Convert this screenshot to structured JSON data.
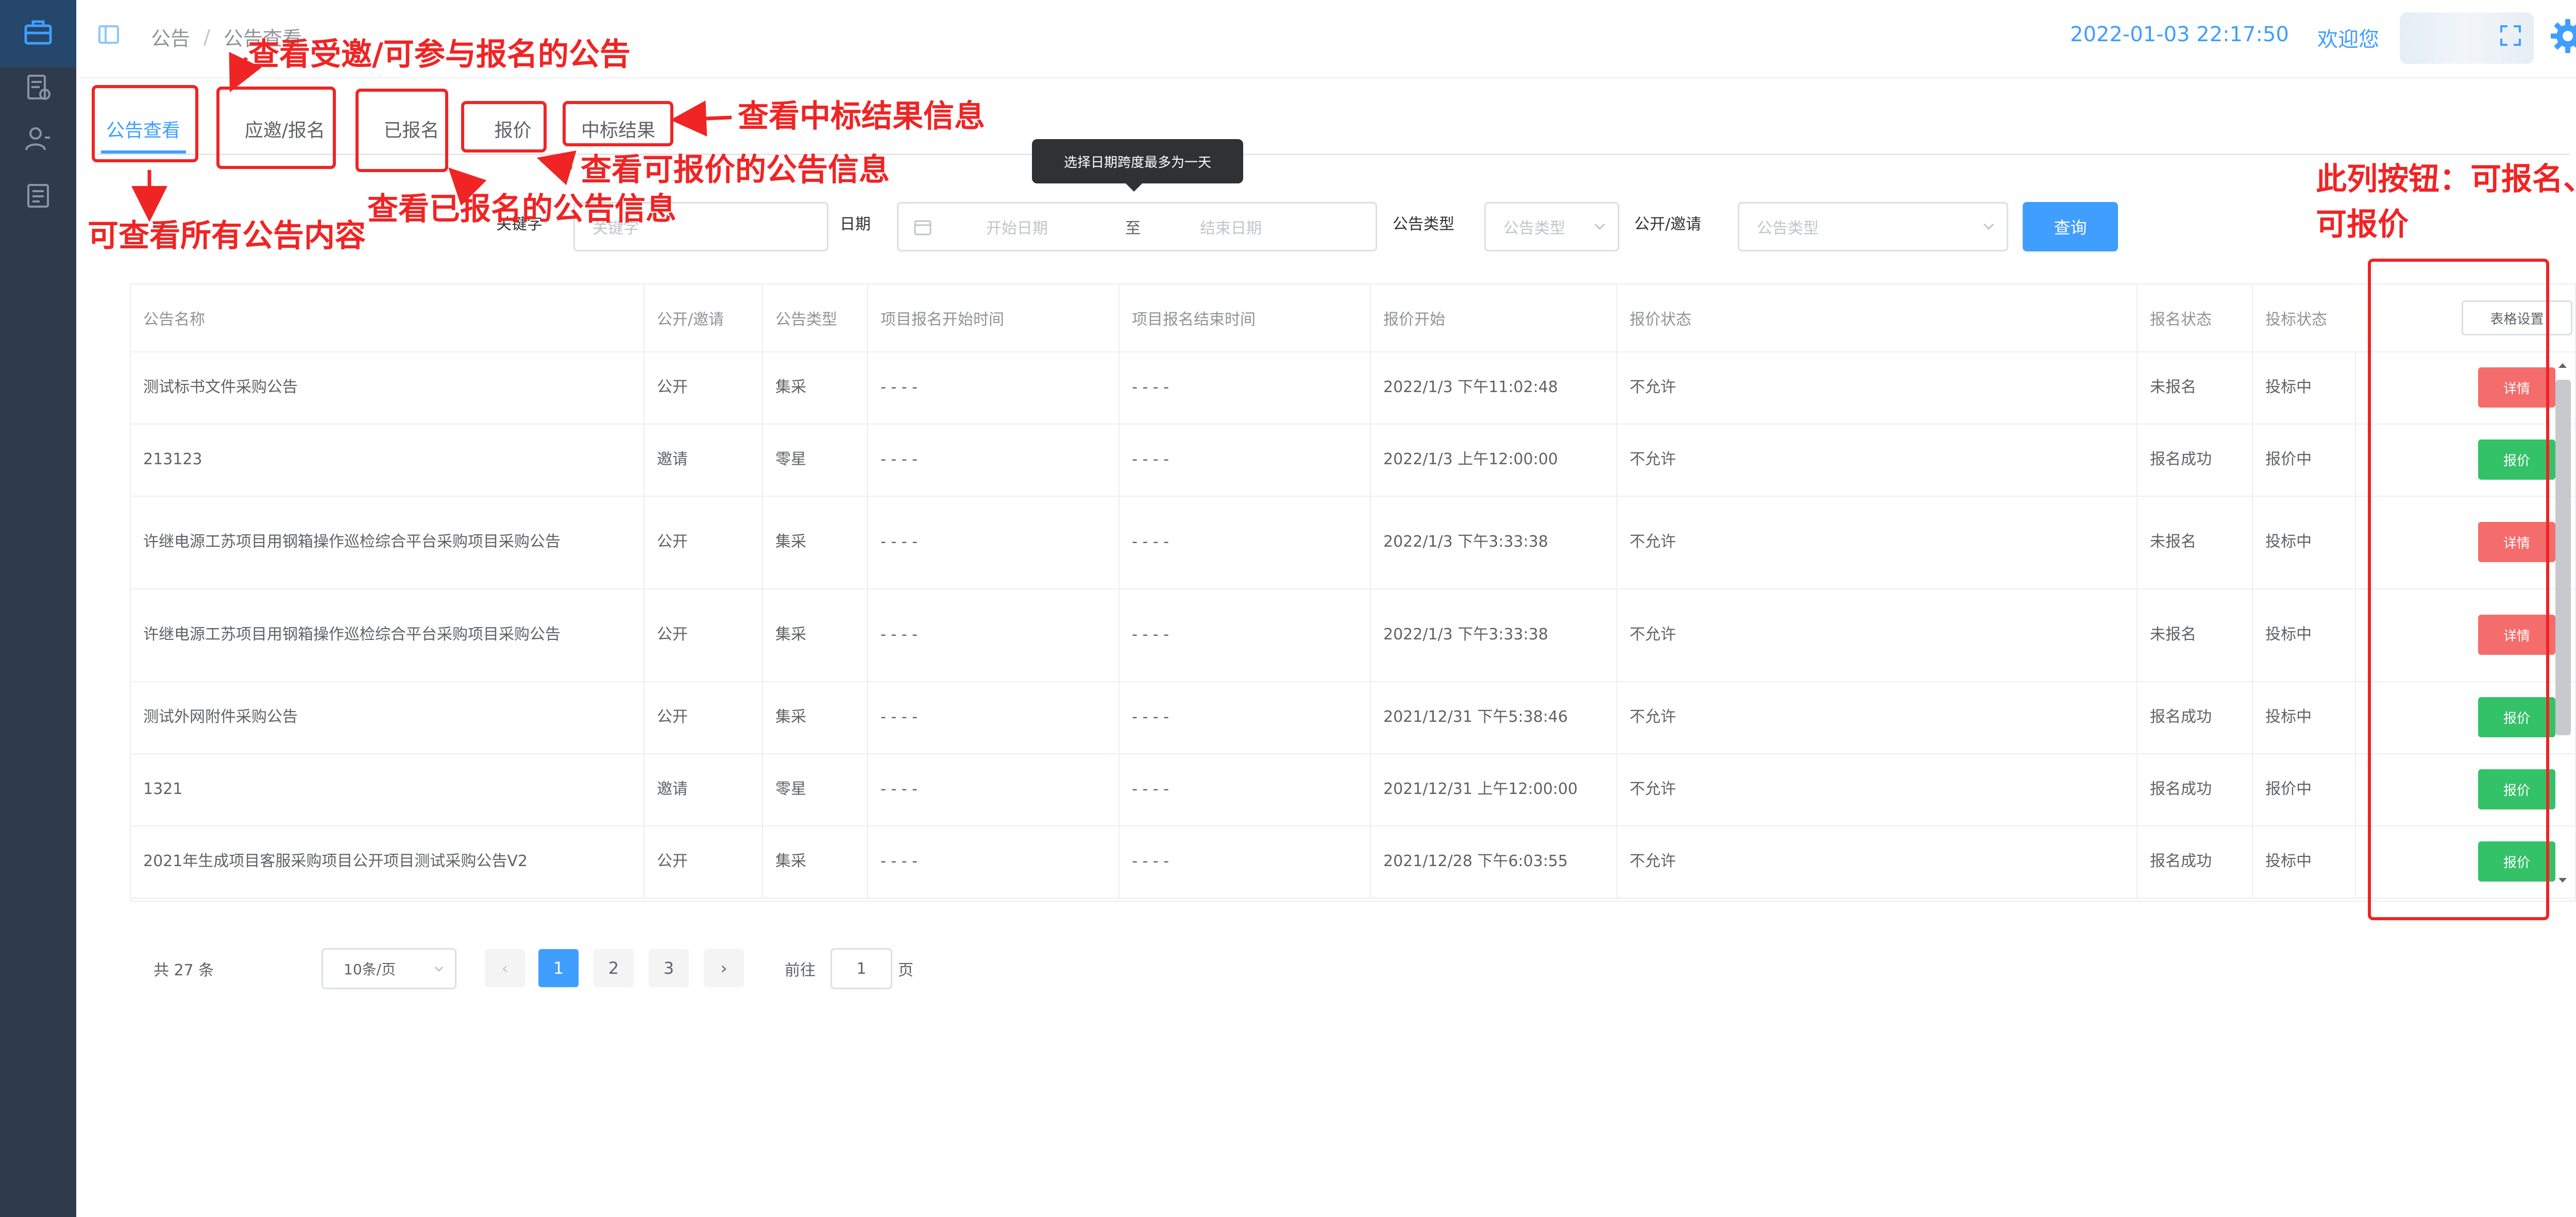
{
  "breadcrumb": {
    "home": "公告",
    "current": "公告查看"
  },
  "header": {
    "datetime": "2022-01-03 22:17:50",
    "welcome": "欢迎您"
  },
  "tabs": [
    {
      "label": "公告查看"
    },
    {
      "label": "应邀/报名"
    },
    {
      "label": "已报名"
    },
    {
      "label": "报价"
    },
    {
      "label": "中标结果"
    }
  ],
  "tooltip": "选择日期跨度最多为一天",
  "filters": {
    "keyword_label": "关键字",
    "keyword_placeholder": "关键字",
    "date_label": "日期",
    "date_start_placeholder": "开始日期",
    "date_sep": "至",
    "date_end_placeholder": "结束日期",
    "type_label": "公告类型",
    "type_placeholder": "公告类型",
    "mode_label": "公开/邀请",
    "mode_placeholder": "公告类型",
    "query_button": "查询"
  },
  "table": {
    "columns": [
      "公告名称",
      "公开/邀请",
      "公告类型",
      "项目报名开始时间",
      "项目报名结束时间",
      "报价开始",
      "报价状态",
      "报名状态",
      "投标状态"
    ],
    "column_settings": "表格设置",
    "rows": [
      {
        "name": "测试标书文件采购公告",
        "mode": "公开",
        "type": "集采",
        "start": "- - - -",
        "end": "- - - -",
        "quote": "2022/1/3 下午11:02:48",
        "qstatus": "不允许",
        "reg": "未报名",
        "bid": "投标中",
        "action": "详情",
        "color": "#f56c6c"
      },
      {
        "name": "213123",
        "mode": "邀请",
        "type": "零星",
        "start": "- - - -",
        "end": "- - - -",
        "quote": "2022/1/3 上午12:00:00",
        "qstatus": "不允许",
        "reg": "报名成功",
        "bid": "报价中",
        "action": "报价",
        "color": "#34c268"
      },
      {
        "name": "许继电源工苏项目用钢箱操作巡检综合平台采购项目采购公告",
        "mode": "公开",
        "type": "集采",
        "start": "- - - -",
        "end": "- - - -",
        "quote": "2022/1/3 下午3:33:38",
        "qstatus": "不允许",
        "reg": "未报名",
        "bid": "投标中",
        "action": "详情",
        "color": "#f56c6c"
      },
      {
        "name": "许继电源工苏项目用钢箱操作巡检综合平台采购项目采购公告",
        "mode": "公开",
        "type": "集采",
        "start": "- - - -",
        "end": "- - - -",
        "quote": "2022/1/3 下午3:33:38",
        "qstatus": "不允许",
        "reg": "未报名",
        "bid": "投标中",
        "action": "详情",
        "color": "#f56c6c"
      },
      {
        "name": "测试外网附件采购公告",
        "mode": "公开",
        "type": "集采",
        "start": "- - - -",
        "end": "- - - -",
        "quote": "2021/12/31 下午5:38:46",
        "qstatus": "不允许",
        "reg": "报名成功",
        "bid": "投标中",
        "action": "报价",
        "color": "#34c268"
      },
      {
        "name": "1321",
        "mode": "邀请",
        "type": "零星",
        "start": "- - - -",
        "end": "- - - -",
        "quote": "2021/12/31 上午12:00:00",
        "qstatus": "不允许",
        "reg": "报名成功",
        "bid": "报价中",
        "action": "报价",
        "color": "#34c268"
      },
      {
        "name": "2021年生成项目客服采购项目公开项目测试采购公告V2",
        "mode": "公开",
        "type": "集采",
        "start": "- - - -",
        "end": "- - - -",
        "quote": "2021/12/28 下午6:03:55",
        "qstatus": "不允许",
        "reg": "报名成功",
        "bid": "投标中",
        "action": "报价",
        "color": "#34c268"
      }
    ]
  },
  "pagination": {
    "total": "共 27 条",
    "page_size": "10条/页",
    "prev": "‹",
    "pages": [
      "1",
      "2",
      "3"
    ],
    "next": "›",
    "goto_label": "前往",
    "goto_value": "1",
    "goto_suffix": "页"
  },
  "annotations": {
    "invited": "查看受邀/可参与报名的公告",
    "winning": "查看中标结果信息",
    "quotable": "查看可报价的公告信息",
    "registered": "查看已报名的公告信息",
    "all": "可查看所有公告内容",
    "column_note_1": "此列按钮：可报名、",
    "column_note_2": "可报价"
  },
  "icons": {
    "sidebar": [
      "notice-icon",
      "document-icon",
      "user-icon",
      "list-icon"
    ],
    "top": [
      "fold-icon",
      "fullscreen-icon",
      "gear-icon",
      "caret-down-icon"
    ]
  },
  "colors": {
    "primary": "#409eff",
    "sidebar": "#2f3a4d",
    "annotation": "#f02424",
    "success": "#34c268",
    "danger": "#f56c6c"
  }
}
